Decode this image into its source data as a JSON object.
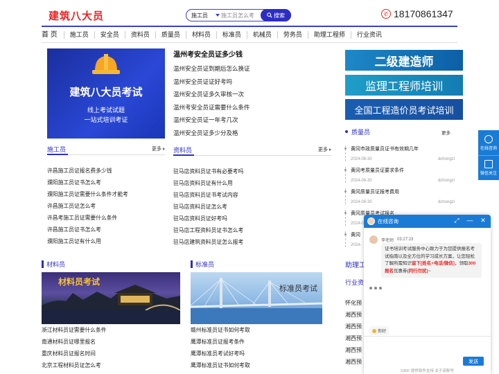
{
  "header": {
    "logo": "建筑八大员",
    "search_select": "施工员",
    "search_placeholder": "施工员怎么考",
    "search_button": "搜索",
    "phone": "18170861347"
  },
  "nav": [
    "首 页",
    "施工员",
    "安全员",
    "资料员",
    "质量员",
    "材料员",
    "标准员",
    "机械员",
    "劳务员",
    "助理工程师",
    "行业资讯"
  ],
  "banner": {
    "title": "建筑八大员考试",
    "line1": "线上考试试题",
    "line2": "一站式培训考证"
  },
  "headline": {
    "title": "温州考安全员证多少钱",
    "items": [
      "温州安全员证到期后怎么换证",
      "温州安全员证证好考吗",
      "温州安全员证多久审核一次",
      "温州考安全员证需要什么条件",
      "温州安全员证一年考几次",
      "温州安全员证多少分及格"
    ]
  },
  "section_builder": {
    "title": "施工员",
    "more": "更多",
    "items": [
      "许昌施工员证报名费多少钱",
      "濮阳施工员证书怎么考",
      "濮阳施工员证需要什么条件才能考",
      "许昌施工员证怎么考",
      "许昌考施工员证需要什么条件",
      "许昌施工员证书怎么考",
      "濮阳施工员证有什么用"
    ]
  },
  "section_data": {
    "title": "资料员",
    "more": "更多",
    "items": [
      "驻马店资料员证书有必要考吗",
      "驻马店资料员证有什么用",
      "驻马店资料员证书考试内容",
      "驻马店资料员证怎么考",
      "驻马店资料员证好考吗",
      "驻马店工程资料员证书怎么考",
      "驻马店建筑资料员证怎么报考"
    ]
  },
  "section_material": {
    "title": "材料员",
    "image_caption": "材料员考试",
    "items": [
      "浙江材料员证需要什么条件",
      "南通材料员证哪里报名",
      "重庆材料员证报名时间",
      "北京工程材料员证怎么考"
    ]
  },
  "section_standard": {
    "title": "标准员",
    "image_caption": "标准员考试",
    "items": [
      "赣州标准员证书如何考取",
      "鹰潭标准员证报考条件",
      "鹰潭标准员考试好考吗",
      "鹰潭标准员证书如何考取"
    ]
  },
  "right": {
    "ads": [
      "二级建造师",
      "监理工程师培训",
      "全国工程造价员考试培训"
    ],
    "quality_title": "质量员",
    "quality_more": "更多",
    "quality_items": [
      {
        "title": "黄冈市政质量员证书有效期几年",
        "date": "2024-08-30",
        "author": "dchongzi"
      },
      {
        "title": "黄冈考质量员证要求条件",
        "date": "2024-08-30",
        "author": "dchongzi"
      },
      {
        "title": "黄冈质量员证报考费用",
        "date": "2024-08-30",
        "author": "dchongzi"
      },
      {
        "title": "黄冈质量员考试报名",
        "date": "2024-08-30",
        "author": "dchongzi"
      },
      {
        "title": "黄冈",
        "date": "2024-",
        "author": ""
      }
    ],
    "assistant_title": "助理工",
    "industry_title": "行业资",
    "industry_items": [
      "怀化预",
      "湘西预",
      "湘西预",
      "湘西预",
      "湘西预",
      "湘西预"
    ]
  },
  "side": {
    "consult": "在线咨询",
    "wechat": "微信关注"
  },
  "chat": {
    "title": "在线咨询",
    "agent": "李老师",
    "time": "03:27:23",
    "msg_intro": "证书培训考试服务中心致力于为您提供报名考试指南以及全方位的学习成长方案，让您轻松了解所需知识",
    "msg_red1": "留下[姓名+电话/微信]",
    "msg_mid": "，领取",
    "msg_red2": "300报名",
    "msg_mid2": "优惠券",
    "msg_red3": "(同行勿扰)",
    "msg_end": "~",
    "quick_reply": "你好",
    "send": "发送",
    "footer": "53KF 提供软件支持  关于该账号"
  }
}
